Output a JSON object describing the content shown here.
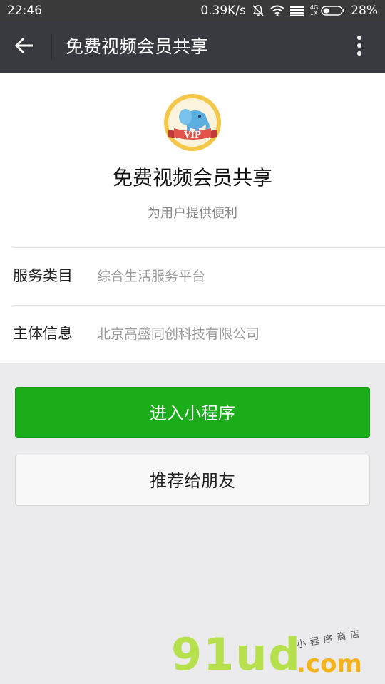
{
  "status_bar": {
    "time": "22:46",
    "speed": "0.39K/s",
    "net_top": "4G",
    "net_bottom": "1X",
    "battery": "28%"
  },
  "title_bar": {
    "title": "免费视频会员共享"
  },
  "profile": {
    "logo_text": "VIP",
    "name": "免费视频会员共享",
    "description": "为用户提供便利"
  },
  "info_rows": [
    {
      "label": "服务类目",
      "value": "综合生活服务平台"
    },
    {
      "label": "主体信息",
      "value": "北京高盛同创科技有限公司"
    }
  ],
  "buttons": {
    "enter": "进入小程序",
    "recommend": "推荐给朋友"
  },
  "watermark": {
    "main": "91ud",
    "domain": ".com",
    "tagline": "小程序商店"
  },
  "colors": {
    "status_bar": "#3a3a3a",
    "title_bar": "#393a3f",
    "primary_green": "#1aad19",
    "page_background": "#ebebee"
  },
  "icons": [
    "back-arrow-icon",
    "more-vertical-icon",
    "mute-bell-icon",
    "wifi-icon",
    "signal-icon",
    "battery-icon"
  ]
}
